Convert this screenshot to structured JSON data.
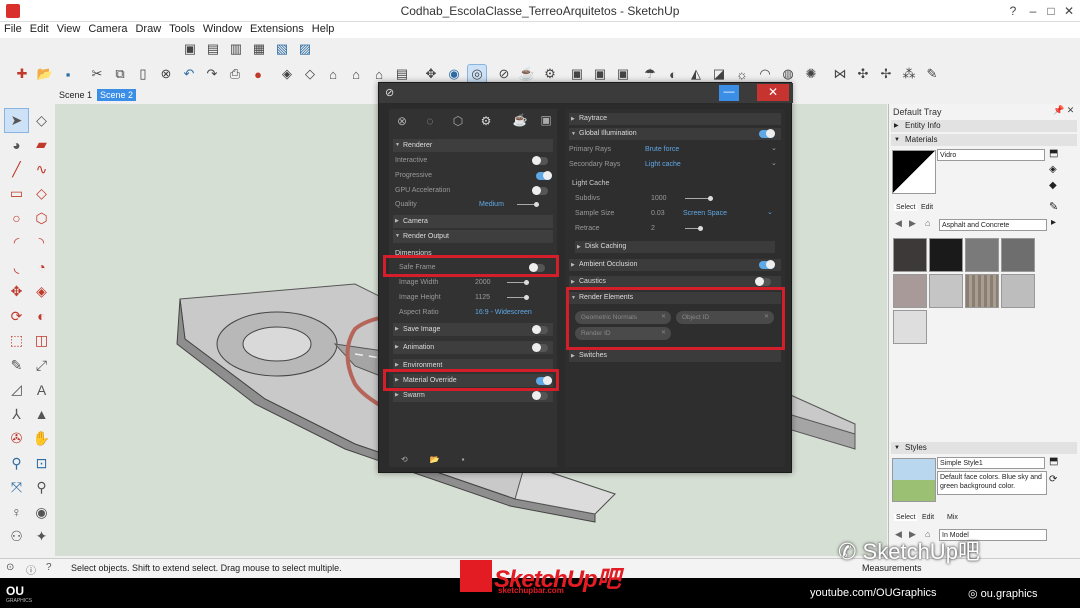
{
  "window": {
    "title": "Codhab_EscolaClasse_TerreoArquitetos - SketchUp"
  },
  "menu": [
    "File",
    "Edit",
    "View",
    "Camera",
    "Draw",
    "Tools",
    "Window",
    "Extensions",
    "Help"
  ],
  "scenes": [
    "Scene 1",
    "Scene 2"
  ],
  "dialog": {
    "renderer": {
      "header": "Renderer",
      "interactive_label": "Interactive",
      "progressive_label": "Progressive",
      "gpu_label": "GPU Acceleration",
      "quality_label": "Quality",
      "quality_value": "Medium"
    },
    "camera_label": "Camera",
    "render_output": {
      "header": "Render Output",
      "dimensions_label": "Dimensions",
      "safe_frame_label": "Safe Frame",
      "image_width_label": "Image Width",
      "image_width_value": "2000",
      "image_height_label": "Image Height",
      "image_height_value": "1125",
      "aspect_ratio_label": "Aspect Ratio",
      "aspect_ratio_value": "16:9 - Widescreen"
    },
    "save_image_label": "Save Image",
    "animation_label": "Animation",
    "environment_label": "Environment",
    "material_override_label": "Material Override",
    "swarm_label": "Swarm",
    "raytrace_label": "Raytrace",
    "gi": {
      "header": "Global Illumination",
      "primary_rays_label": "Primary Rays",
      "primary_rays_value": "Brute force",
      "secondary_rays_label": "Secondary Rays",
      "secondary_rays_value": "Light cache"
    },
    "light_cache": {
      "header": "Light Cache",
      "subdivs_label": "Subdivs",
      "subdivs_value": "1000",
      "sample_size_label": "Sample Size",
      "sample_size_value": "0.03",
      "sample_size_mode": "Screen Space",
      "retrace_label": "Retrace",
      "retrace_value": "2"
    },
    "disk_caching_label": "Disk Caching",
    "ambient_occlusion_label": "Ambient Occlusion",
    "caustics_label": "Caustics",
    "render_elements": {
      "header": "Render Elements",
      "chips": [
        "Geometric Normals",
        "Object ID",
        "Render ID"
      ]
    },
    "switches_label": "Switches"
  },
  "tray": {
    "title": "Default Tray",
    "entity_info_label": "Entity Info",
    "materials_label": "Materials",
    "material_name": "Vidro",
    "select_tab": "Select",
    "edit_tab": "Edit",
    "library_value": "Asphalt and Concrete",
    "styles_label": "Styles",
    "style_name": "Simple Style1",
    "style_desc": "Default face colors. Blue sky and green background color.",
    "styles_tabs": [
      "Select",
      "Edit",
      "Mix"
    ],
    "style_library_value": "In Model"
  },
  "status": {
    "text": "Select objects. Shift to extend select. Drag mouse to select multiple.",
    "right": "Measurements"
  },
  "banner": {
    "ou": "OU",
    "ou_sub": "GRAPHICS",
    "youtube": "youtube.com/OUGraphics",
    "instagram": "ou.graphics"
  },
  "watermark": {
    "logo_text": "SketchUp吧",
    "logo_sub": "sketchupbar.com",
    "corner_text": "SketchUp吧"
  }
}
